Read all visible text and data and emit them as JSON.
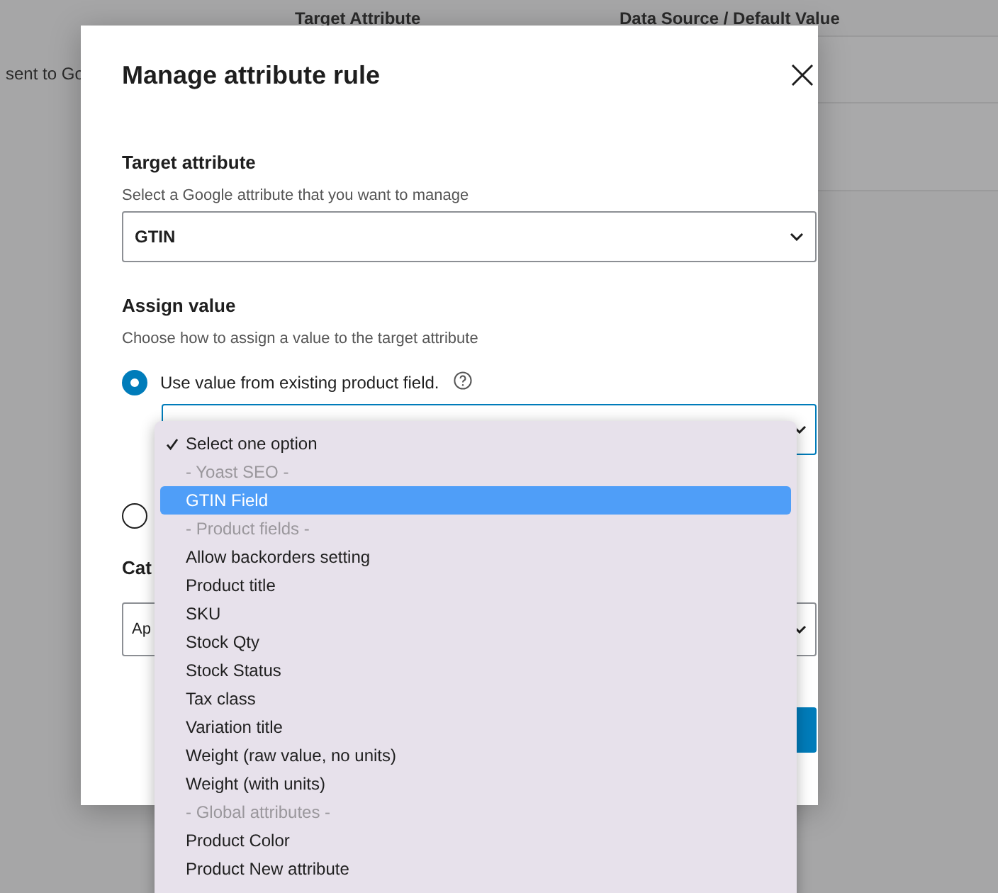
{
  "background": {
    "columns": [
      "Target Attribute",
      "Data Source / Default Value"
    ],
    "side_text": "sent to Go"
  },
  "dialog": {
    "title": "Manage attribute rule",
    "target": {
      "label": "Target attribute",
      "help": "Select a Google attribute that you want to manage",
      "value": "GTIN"
    },
    "assign": {
      "label": "Assign value",
      "help": "Choose how to assign a value to the target attribute",
      "radios": [
        {
          "label": "Use value from existing product field.",
          "selected": true
        },
        {
          "selected": false
        }
      ]
    },
    "category": {
      "label": "Cat",
      "value": "Ap"
    },
    "options": [
      {
        "kind": "option",
        "label": "Select one option",
        "checked": true,
        "selected": false
      },
      {
        "kind": "group",
        "label": "- Yoast SEO -"
      },
      {
        "kind": "option",
        "label": "GTIN Field",
        "checked": false,
        "selected": true
      },
      {
        "kind": "group",
        "label": "- Product fields -"
      },
      {
        "kind": "option",
        "label": "Allow backorders setting",
        "checked": false,
        "selected": false
      },
      {
        "kind": "option",
        "label": "Product title",
        "checked": false,
        "selected": false
      },
      {
        "kind": "option",
        "label": "SKU",
        "checked": false,
        "selected": false
      },
      {
        "kind": "option",
        "label": "Stock Qty",
        "checked": false,
        "selected": false
      },
      {
        "kind": "option",
        "label": "Stock Status",
        "checked": false,
        "selected": false
      },
      {
        "kind": "option",
        "label": "Tax class",
        "checked": false,
        "selected": false
      },
      {
        "kind": "option",
        "label": "Variation title",
        "checked": false,
        "selected": false
      },
      {
        "kind": "option",
        "label": "Weight (raw value, no units)",
        "checked": false,
        "selected": false
      },
      {
        "kind": "option",
        "label": "Weight (with units)",
        "checked": false,
        "selected": false
      },
      {
        "kind": "group",
        "label": "- Global attributes -"
      },
      {
        "kind": "option",
        "label": "Product Color",
        "checked": false,
        "selected": false
      },
      {
        "kind": "option",
        "label": "Product New attribute",
        "checked": false,
        "selected": false
      }
    ]
  }
}
